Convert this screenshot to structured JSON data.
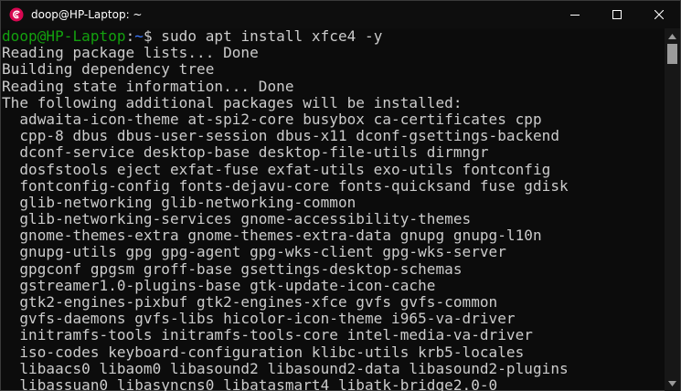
{
  "window": {
    "title": "doop@HP-Laptop: ~",
    "app_icon": "debian-swirl-icon",
    "accent_color": "#d70751"
  },
  "controls": {
    "minimize_icon": "minimize-icon",
    "maximize_icon": "maximize-icon",
    "close_icon": "close-icon"
  },
  "terminal": {
    "prompt_user": "doop@HP-Laptop",
    "prompt_sep": ":",
    "prompt_path": "~",
    "prompt_symbol": "$",
    "command": " sudo apt install xfce4 -y",
    "output": [
      "Reading package lists... Done",
      "Building dependency tree",
      "Reading state information... Done",
      "The following additional packages will be installed:",
      "  adwaita-icon-theme at-spi2-core busybox ca-certificates cpp",
      "  cpp-8 dbus dbus-user-session dbus-x11 dconf-gsettings-backend",
      "  dconf-service desktop-base desktop-file-utils dirmngr",
      "  dosfstools eject exfat-fuse exfat-utils exo-utils fontconfig",
      "  fontconfig-config fonts-dejavu-core fonts-quicksand fuse gdisk",
      "  glib-networking glib-networking-common",
      "  glib-networking-services gnome-accessibility-themes",
      "  gnome-themes-extra gnome-themes-extra-data gnupg gnupg-l10n",
      "  gnupg-utils gpg gpg-agent gpg-wks-client gpg-wks-server",
      "  gpgconf gpgsm groff-base gsettings-desktop-schemas",
      "  gstreamer1.0-plugins-base gtk-update-icon-cache",
      "  gtk2-engines-pixbuf gtk2-engines-xfce gvfs gvfs-common",
      "  gvfs-daemons gvfs-libs hicolor-icon-theme i965-va-driver",
      "  initramfs-tools initramfs-tools-core intel-media-va-driver",
      "  iso-codes keyboard-configuration klibc-utils krb5-locales",
      "  libaacs0 libaom0 libasound2 libasound2-data libasound2-plugins",
      "  libassuan0 libasyncns0 libatasmart4 libatk-bridge2.0-0"
    ]
  },
  "scrollbar": {
    "up_icon": "scroll-up-arrow-icon",
    "down_icon": "scroll-down-arrow-icon"
  }
}
